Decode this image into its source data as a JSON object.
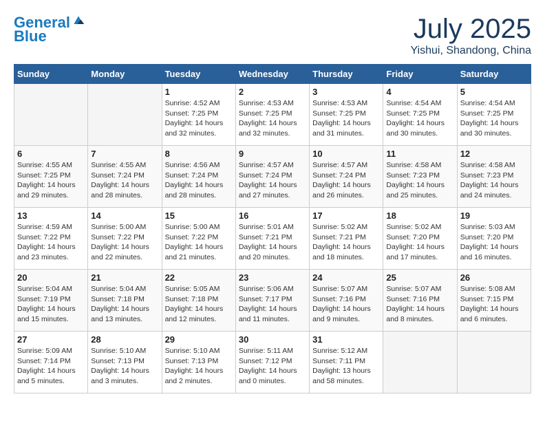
{
  "logo": {
    "line1": "General",
    "line2": "Blue"
  },
  "title": "July 2025",
  "subtitle": "Yishui, Shandong, China",
  "days_of_week": [
    "Sunday",
    "Monday",
    "Tuesday",
    "Wednesday",
    "Thursday",
    "Friday",
    "Saturday"
  ],
  "weeks": [
    [
      {
        "day": "",
        "info": ""
      },
      {
        "day": "",
        "info": ""
      },
      {
        "day": "1",
        "info": "Sunrise: 4:52 AM\nSunset: 7:25 PM\nDaylight: 14 hours and 32 minutes."
      },
      {
        "day": "2",
        "info": "Sunrise: 4:53 AM\nSunset: 7:25 PM\nDaylight: 14 hours and 32 minutes."
      },
      {
        "day": "3",
        "info": "Sunrise: 4:53 AM\nSunset: 7:25 PM\nDaylight: 14 hours and 31 minutes."
      },
      {
        "day": "4",
        "info": "Sunrise: 4:54 AM\nSunset: 7:25 PM\nDaylight: 14 hours and 30 minutes."
      },
      {
        "day": "5",
        "info": "Sunrise: 4:54 AM\nSunset: 7:25 PM\nDaylight: 14 hours and 30 minutes."
      }
    ],
    [
      {
        "day": "6",
        "info": "Sunrise: 4:55 AM\nSunset: 7:25 PM\nDaylight: 14 hours and 29 minutes."
      },
      {
        "day": "7",
        "info": "Sunrise: 4:55 AM\nSunset: 7:24 PM\nDaylight: 14 hours and 28 minutes."
      },
      {
        "day": "8",
        "info": "Sunrise: 4:56 AM\nSunset: 7:24 PM\nDaylight: 14 hours and 28 minutes."
      },
      {
        "day": "9",
        "info": "Sunrise: 4:57 AM\nSunset: 7:24 PM\nDaylight: 14 hours and 27 minutes."
      },
      {
        "day": "10",
        "info": "Sunrise: 4:57 AM\nSunset: 7:24 PM\nDaylight: 14 hours and 26 minutes."
      },
      {
        "day": "11",
        "info": "Sunrise: 4:58 AM\nSunset: 7:23 PM\nDaylight: 14 hours and 25 minutes."
      },
      {
        "day": "12",
        "info": "Sunrise: 4:58 AM\nSunset: 7:23 PM\nDaylight: 14 hours and 24 minutes."
      }
    ],
    [
      {
        "day": "13",
        "info": "Sunrise: 4:59 AM\nSunset: 7:22 PM\nDaylight: 14 hours and 23 minutes."
      },
      {
        "day": "14",
        "info": "Sunrise: 5:00 AM\nSunset: 7:22 PM\nDaylight: 14 hours and 22 minutes."
      },
      {
        "day": "15",
        "info": "Sunrise: 5:00 AM\nSunset: 7:22 PM\nDaylight: 14 hours and 21 minutes."
      },
      {
        "day": "16",
        "info": "Sunrise: 5:01 AM\nSunset: 7:21 PM\nDaylight: 14 hours and 20 minutes."
      },
      {
        "day": "17",
        "info": "Sunrise: 5:02 AM\nSunset: 7:21 PM\nDaylight: 14 hours and 18 minutes."
      },
      {
        "day": "18",
        "info": "Sunrise: 5:02 AM\nSunset: 7:20 PM\nDaylight: 14 hours and 17 minutes."
      },
      {
        "day": "19",
        "info": "Sunrise: 5:03 AM\nSunset: 7:20 PM\nDaylight: 14 hours and 16 minutes."
      }
    ],
    [
      {
        "day": "20",
        "info": "Sunrise: 5:04 AM\nSunset: 7:19 PM\nDaylight: 14 hours and 15 minutes."
      },
      {
        "day": "21",
        "info": "Sunrise: 5:04 AM\nSunset: 7:18 PM\nDaylight: 14 hours and 13 minutes."
      },
      {
        "day": "22",
        "info": "Sunrise: 5:05 AM\nSunset: 7:18 PM\nDaylight: 14 hours and 12 minutes."
      },
      {
        "day": "23",
        "info": "Sunrise: 5:06 AM\nSunset: 7:17 PM\nDaylight: 14 hours and 11 minutes."
      },
      {
        "day": "24",
        "info": "Sunrise: 5:07 AM\nSunset: 7:16 PM\nDaylight: 14 hours and 9 minutes."
      },
      {
        "day": "25",
        "info": "Sunrise: 5:07 AM\nSunset: 7:16 PM\nDaylight: 14 hours and 8 minutes."
      },
      {
        "day": "26",
        "info": "Sunrise: 5:08 AM\nSunset: 7:15 PM\nDaylight: 14 hours and 6 minutes."
      }
    ],
    [
      {
        "day": "27",
        "info": "Sunrise: 5:09 AM\nSunset: 7:14 PM\nDaylight: 14 hours and 5 minutes."
      },
      {
        "day": "28",
        "info": "Sunrise: 5:10 AM\nSunset: 7:13 PM\nDaylight: 14 hours and 3 minutes."
      },
      {
        "day": "29",
        "info": "Sunrise: 5:10 AM\nSunset: 7:13 PM\nDaylight: 14 hours and 2 minutes."
      },
      {
        "day": "30",
        "info": "Sunrise: 5:11 AM\nSunset: 7:12 PM\nDaylight: 14 hours and 0 minutes."
      },
      {
        "day": "31",
        "info": "Sunrise: 5:12 AM\nSunset: 7:11 PM\nDaylight: 13 hours and 58 minutes."
      },
      {
        "day": "",
        "info": ""
      },
      {
        "day": "",
        "info": ""
      }
    ]
  ]
}
